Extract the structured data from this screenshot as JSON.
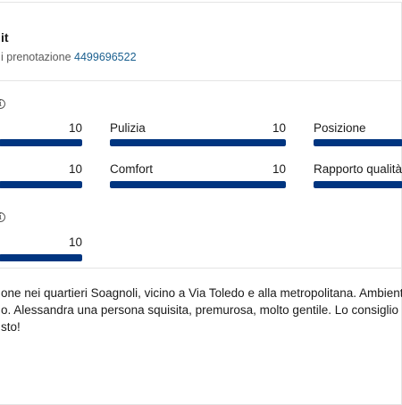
{
  "header": {
    "title_fragment": "it",
    "booking_label_fragment": "i prenotazione",
    "booking_number": "4499696522"
  },
  "ratings": {
    "row1": [
      {
        "label": "",
        "score": "10",
        "fraction": 1.0
      },
      {
        "label": "Pulizia",
        "score": "10",
        "fraction": 1.0
      },
      {
        "label": "Posizione",
        "score": "",
        "fraction": 1.0
      }
    ],
    "row2": [
      {
        "label": "",
        "score": "10",
        "fraction": 1.0
      },
      {
        "label": "Comfort",
        "score": "10",
        "fraction": 1.0
      },
      {
        "label": "Rapporto qualità",
        "score": "",
        "fraction": 1.0
      }
    ]
  },
  "extra_rating": {
    "label": "",
    "score": "10",
    "fraction": 1.0
  },
  "info_glyph": "i",
  "review": {
    "line1": "one nei quartieri Soagnoli, vicino a Via Toledo e alla metropolitana. Ambient",
    "line2": "o. Alessandra una persona squisita, premurosa, molto gentile. Lo consiglio e",
    "line3": "sto!"
  },
  "colors": {
    "bar_fill": "#003580",
    "link": "#1a5f8f"
  }
}
